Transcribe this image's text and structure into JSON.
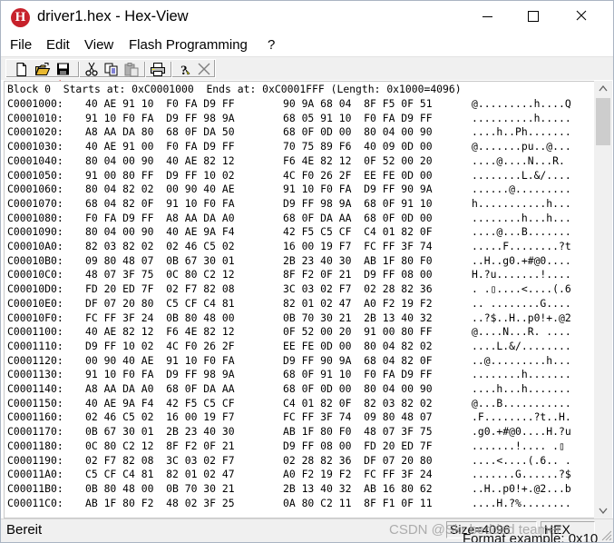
{
  "window": {
    "title": "driver1.hex - Hex-View",
    "app_icon_letter": "H",
    "controls": [
      "minimize-icon",
      "maximize-icon",
      "close-icon"
    ]
  },
  "menu": [
    "File",
    "Edit",
    "View",
    "Flash Programming",
    "?"
  ],
  "toolbar": {
    "buttons": [
      "new-file-icon",
      "open-folder-icon",
      "save-icon",
      "cut-icon",
      "copy-icon",
      "paste-icon",
      "print-icon",
      "help-icon",
      "close-x-icon"
    ],
    "annotation": "red-arrow-icon pointing at save button"
  },
  "header_line": "Block 0  Starts at: 0xC0001000  Ends at: 0xC0001FFF (Length: 0x1000=4096)",
  "rows": [
    [
      "C0001000:",
      "40 AE 91 10  F0 FA D9 FF",
      "90 9A 68 04  8F F5 0F 51",
      "@.........h....Q"
    ],
    [
      "C0001010:",
      "91 10 F0 FA  D9 FF 98 9A",
      "68 05 91 10  F0 FA D9 FF",
      "..........h....."
    ],
    [
      "C0001020:",
      "A8 AA DA 80  68 0F DA 50",
      "68 0F 0D 00  80 04 00 90",
      "....h..Ph......."
    ],
    [
      "C0001030:",
      "40 AE 91 00  F0 FA D9 FF",
      "70 75 89 F6  40 09 0D 00",
      "@.......pu..@..."
    ],
    [
      "C0001040:",
      "80 04 00 90  40 AE 82 12",
      "F6 4E 82 12  0F 52 00 20",
      "....@....N...R. "
    ],
    [
      "C0001050:",
      "91 00 80 FF  D9 FF 10 02",
      "4C F0 26 2F  EE FE 0D 00",
      "........L.&/...."
    ],
    [
      "C0001060:",
      "80 04 82 02  00 90 40 AE",
      "91 10 F0 FA  D9 FF 90 9A",
      "......@........."
    ],
    [
      "C0001070:",
      "68 04 82 0F  91 10 F0 FA",
      "D9 FF 98 9A  68 0F 91 10",
      "h...........h..."
    ],
    [
      "C0001080:",
      "F0 FA D9 FF  A8 AA DA A0",
      "68 0F DA AA  68 0F 0D 00",
      "........h...h..."
    ],
    [
      "C0001090:",
      "80 04 00 90  40 AE 9A F4",
      "42 F5 C5 CF  C4 01 82 0F",
      "....@...B......."
    ],
    [
      "C00010A0:",
      "82 03 82 02  02 46 C5 02",
      "16 00 19 F7  FC FF 3F 74",
      ".....F........?t"
    ],
    [
      "C00010B0:",
      "09 80 48 07  0B 67 30 01",
      "2B 23 40 30  AB 1F 80 F0",
      "..H..g0.+#@0...."
    ],
    [
      "C00010C0:",
      "48 07 3F 75  0C 80 C2 12",
      "8F F2 0F 21  D9 FF 08 00",
      "H.?u.......!...."
    ],
    [
      "C00010D0:",
      "FD 20 ED 7F  02 F7 82 08",
      "3C 03 02 F7  02 28 82 36",
      ". .▯....<....(.6"
    ],
    [
      "C00010E0:",
      "DF 07 20 80  C5 CF C4 81",
      "82 01 02 47  A0 F2 19 F2",
      ".. ........G...."
    ],
    [
      "C00010F0:",
      "FC FF 3F 24  0B 80 48 00",
      "0B 70 30 21  2B 13 40 32",
      "..?$..H..p0!+.@2"
    ],
    [
      "C0001100:",
      "40 AE 82 12  F6 4E 82 12",
      "0F 52 00 20  91 00 80 FF",
      "@....N...R. ...."
    ],
    [
      "C0001110:",
      "D9 FF 10 02  4C F0 26 2F",
      "EE FE 0D 00  80 04 82 02",
      "....L.&/........"
    ],
    [
      "C0001120:",
      "00 90 40 AE  91 10 F0 FA",
      "D9 FF 90 9A  68 04 82 0F",
      "..@.........h..."
    ],
    [
      "C0001130:",
      "91 10 F0 FA  D9 FF 98 9A",
      "68 0F 91 10  F0 FA D9 FF",
      "........h......."
    ],
    [
      "C0001140:",
      "A8 AA DA A0  68 0F DA AA",
      "68 0F 0D 00  80 04 00 90",
      "....h...h......."
    ],
    [
      "C0001150:",
      "40 AE 9A F4  42 F5 C5 CF",
      "C4 01 82 0F  82 03 82 02",
      "@...B..........."
    ],
    [
      "C0001160:",
      "02 46 C5 02  16 00 19 F7",
      "FC FF 3F 74  09 80 48 07",
      ".F........?t..H."
    ],
    [
      "C0001170:",
      "0B 67 30 01  2B 23 40 30",
      "AB 1F 80 F0  48 07 3F 75",
      ".g0.+#@0....H.?u"
    ],
    [
      "C0001180:",
      "0C 80 C2 12  8F F2 0F 21",
      "D9 FF 08 00  FD 20 ED 7F",
      ".......!.... .▯"
    ],
    [
      "C0001190:",
      "02 F7 82 08  3C 03 02 F7",
      "02 28 82 36  DF 07 20 80",
      "....<....(.6.. ."
    ],
    [
      "C00011A0:",
      "C5 CF C4 81  82 01 02 47",
      "A0 F2 19 F2  FC FF 3F 24",
      ".......G......?$"
    ],
    [
      "C00011B0:",
      "0B 80 48 00  0B 70 30 21",
      "2B 13 40 32  AB 16 80 62",
      "..H..p0!+.@2...b"
    ],
    [
      "C00011C0:",
      "AB 1F 80 F2  48 02 3F 25",
      "0A 80 C2 11  8F F1 0F 11",
      "....H.?%........"
    ]
  ],
  "status": {
    "left": "Bereit",
    "size": "Size=4096",
    "mode": "HEX"
  },
  "watermark": "CSDN @Skr bedded teamer",
  "overflow_text": "Format example: 0x10"
}
